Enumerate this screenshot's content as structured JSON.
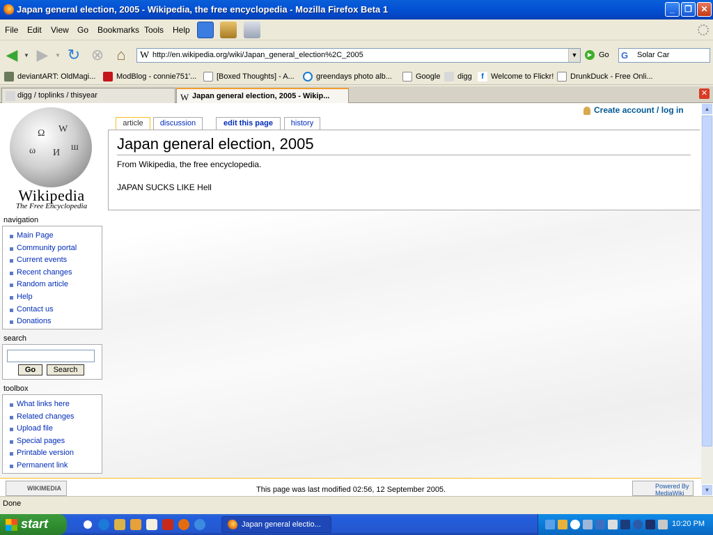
{
  "window": {
    "title": "Japan general election, 2005 - Wikipedia, the free encyclopedia - Mozilla Firefox Beta 1"
  },
  "menubar": {
    "items": [
      "File",
      "Edit",
      "View",
      "Go",
      "Bookmarks",
      "Tools",
      "Help"
    ]
  },
  "navbar": {
    "url": "http://en.wikipedia.org/wiki/Japan_general_election%2C_2005",
    "go_label": "Go",
    "search_value": "Solar Car"
  },
  "bookmarks": [
    "deviantART: OldMagi...",
    "ModBlog - connie751'...",
    "[Boxed Thoughts] - A...",
    "greendays photo alb...",
    "Google",
    "digg",
    "Welcome to Flickr!",
    "DrunkDuck - Free Onli..."
  ],
  "tabs": [
    "digg / toplinks / thisyear",
    "Japan general election, 2005 - Wikip..."
  ],
  "wiki": {
    "logo_title": "Wikipedia",
    "logo_subtitle": "The Free Encyclopedia",
    "login": "Create account / log in",
    "content_tabs": [
      "article",
      "discussion",
      "edit this page",
      "history"
    ],
    "heading": "Japan general election, 2005",
    "from": "From Wikipedia, the free encyclopedia.",
    "body": "JAPAN SUCKS LIKE Hell",
    "navigation_heading": "navigation",
    "navigation": [
      "Main Page",
      "Community portal",
      "Current events",
      "Recent changes",
      "Random article",
      "Help",
      "Contact us",
      "Donations"
    ],
    "search_heading": "search",
    "search_go": "Go",
    "search_search": "Search",
    "toolbox_heading": "toolbox",
    "toolbox": [
      "What links here",
      "Related changes",
      "Upload file",
      "Special pages",
      "Printable version",
      "Permanent link"
    ],
    "footer_modified": "This page was last modified 02:56, 12 September 2005.",
    "wikimedia_logo": "WIKIMEDIA",
    "mediawiki_logo": "Powered By MediaWiki"
  },
  "status": "Done",
  "taskbar": {
    "start": "start",
    "task": "Japan general electio...",
    "clock": "10:20 PM"
  },
  "colors": {
    "title_bar": "#0453d6",
    "link": "#002bb8",
    "tab_highlight": "#fabd23",
    "start_button": "#2f8b2f"
  }
}
